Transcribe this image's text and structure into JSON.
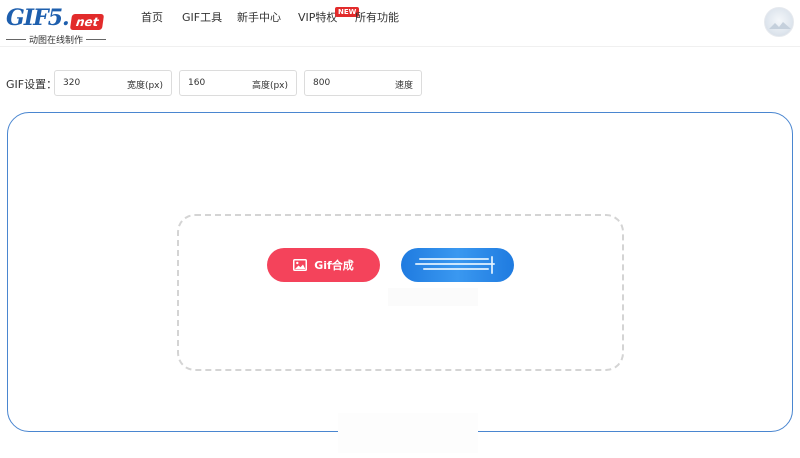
{
  "brand": {
    "logo_text": "GIF5.",
    "logo_badge": "net",
    "tagline": "动图在线制作"
  },
  "nav": {
    "items": [
      {
        "label": "首页"
      },
      {
        "label": "GIF工具"
      },
      {
        "label": "新手中心"
      },
      {
        "label": "VIP特权"
      },
      {
        "label": "所有功能"
      }
    ],
    "new_badge": "NEW"
  },
  "settings": {
    "label": "GIF设置：",
    "width": {
      "value": "320",
      "unit": "宽度(px)"
    },
    "height": {
      "value": "160",
      "unit": "高度(px)"
    },
    "speed": {
      "value": "800",
      "unit": "速度"
    }
  },
  "actions": {
    "compose_label": "Gif合成",
    "compose_icon": "image-icon"
  },
  "colors": {
    "brand_blue": "#1e5fae",
    "accent_red": "#f4435b",
    "upload_blue": "#2a8ae8",
    "frame_border": "#4a86d0"
  }
}
